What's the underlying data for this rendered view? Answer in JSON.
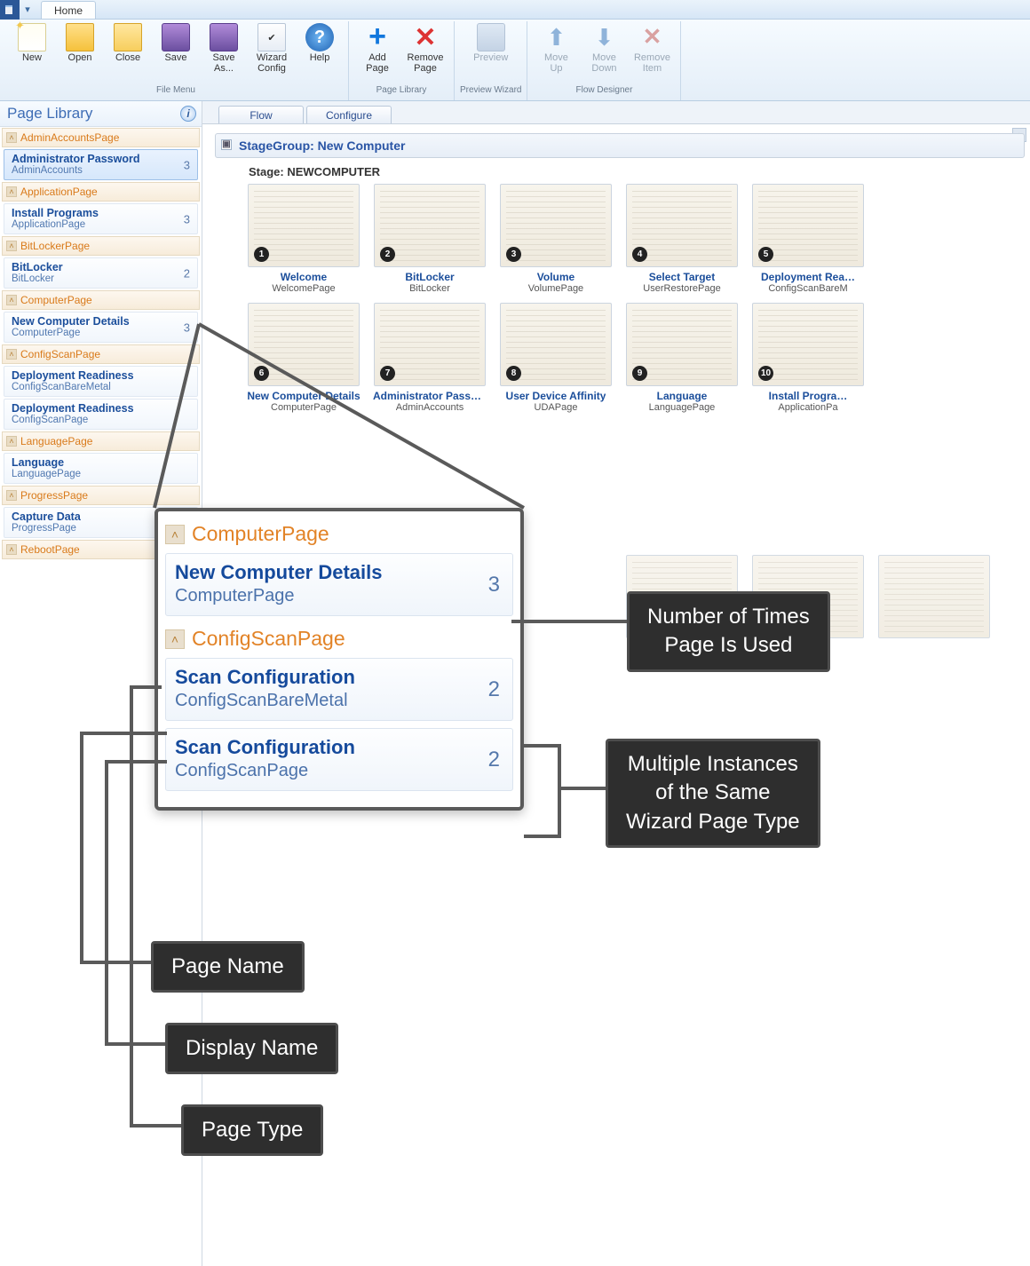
{
  "titlebar": {
    "home_tab": "Home"
  },
  "ribbon": {
    "groups": [
      {
        "label": "File Menu",
        "buttons": [
          {
            "name": "new-button",
            "label": "New",
            "icon": "new"
          },
          {
            "name": "open-button",
            "label": "Open",
            "icon": "folder"
          },
          {
            "name": "close-button",
            "label": "Close",
            "icon": "folder-closed"
          },
          {
            "name": "save-button",
            "label": "Save",
            "icon": "disk"
          },
          {
            "name": "save-as-button",
            "label": "Save\nAs...",
            "icon": "disk"
          },
          {
            "name": "wizard-config-button",
            "label": "Wizard\nConfig",
            "icon": "check"
          },
          {
            "name": "help-button",
            "label": "Help",
            "icon": "help"
          }
        ]
      },
      {
        "label": "Page Library",
        "buttons": [
          {
            "name": "add-page-button",
            "label": "Add\nPage",
            "icon": "plus"
          },
          {
            "name": "remove-page-button",
            "label": "Remove\nPage",
            "icon": "x"
          }
        ]
      },
      {
        "label": "Preview Wizard",
        "buttons": [
          {
            "name": "preview-button",
            "label": "Preview",
            "icon": "prev",
            "dim": true
          }
        ]
      },
      {
        "label": "Flow Designer",
        "buttons": [
          {
            "name": "move-up-button",
            "label": "Move\nUp",
            "icon": "up",
            "dim": true
          },
          {
            "name": "move-down-button",
            "label": "Move\nDown",
            "icon": "down",
            "dim": true
          },
          {
            "name": "remove-item-button",
            "label": "Remove\nItem",
            "icon": "yx",
            "dim": true
          }
        ]
      }
    ]
  },
  "sidebar": {
    "title": "Page Library",
    "groups": [
      {
        "head": "AdminAccountsPage",
        "items": [
          {
            "title": "Administrator Password",
            "sub": "AdminAccounts",
            "count": "3",
            "sel": true
          }
        ]
      },
      {
        "head": "ApplicationPage",
        "items": [
          {
            "title": "Install Programs",
            "sub": "ApplicationPage",
            "count": "3"
          }
        ]
      },
      {
        "head": "BitLockerPage",
        "items": [
          {
            "title": "BitLocker",
            "sub": "BitLocker",
            "count": "2"
          }
        ]
      },
      {
        "head": "ComputerPage",
        "items": [
          {
            "title": "New Computer Details",
            "sub": "ComputerPage",
            "count": "3"
          }
        ]
      },
      {
        "head": "ConfigScanPage",
        "items": [
          {
            "title": "Deployment Readiness",
            "sub": "ConfigScanBareMetal",
            "count": ""
          },
          {
            "title": "Deployment Readiness",
            "sub": "ConfigScanPage",
            "count": ""
          }
        ]
      },
      {
        "head": "LanguagePage",
        "items": [
          {
            "title": "Language",
            "sub": "LanguagePage",
            "count": ""
          }
        ]
      },
      {
        "head": "ProgressPage",
        "items": [
          {
            "title": "Capture Data",
            "sub": "ProgressPage",
            "count": ""
          }
        ]
      },
      {
        "head": "RebootPage",
        "items": []
      }
    ]
  },
  "subtabs": {
    "flow": "Flow",
    "configure": "Configure"
  },
  "stage": {
    "group_label": "StageGroup: New Computer",
    "stage_label": "Stage: NEWCOMPUTER",
    "row1": [
      {
        "n": "1",
        "title": "Welcome",
        "sub": "WelcomePage"
      },
      {
        "n": "2",
        "title": "BitLocker",
        "sub": "BitLocker"
      },
      {
        "n": "3",
        "title": "Volume",
        "sub": "VolumePage"
      },
      {
        "n": "4",
        "title": "Select Target",
        "sub": "UserRestorePage"
      },
      {
        "n": "5",
        "title": "Deployment Rea…",
        "sub": "ConfigScanBareM"
      }
    ],
    "row2": [
      {
        "n": "6",
        "title": "New Computer Details",
        "sub": "ComputerPage"
      },
      {
        "n": "7",
        "title": "Administrator Passw…",
        "sub": "AdminAccounts"
      },
      {
        "n": "8",
        "title": "User Device Affinity",
        "sub": "UDAPage"
      },
      {
        "n": "9",
        "title": "Language",
        "sub": "LanguagePage"
      },
      {
        "n": "10",
        "title": "Install Progra…",
        "sub": "ApplicationPa"
      }
    ]
  },
  "callout_panel": {
    "group1": "ComputerPage",
    "item1": {
      "title": "New Computer Details",
      "sub": "ComputerPage",
      "count": "3"
    },
    "group2": "ConfigScanPage",
    "item2": {
      "title": "Scan Configuration",
      "sub": "ConfigScanBareMetal",
      "count": "2"
    },
    "item3": {
      "title": "Scan Configuration",
      "sub": "ConfigScanPage",
      "count": "2"
    }
  },
  "annotations": {
    "times_used": "Number of Times\nPage Is Used",
    "multiple": "Multiple Instances\nof the Same\nWizard Page Type",
    "page_name": "Page Name",
    "display_name": "Display Name",
    "page_type": "Page Type"
  }
}
